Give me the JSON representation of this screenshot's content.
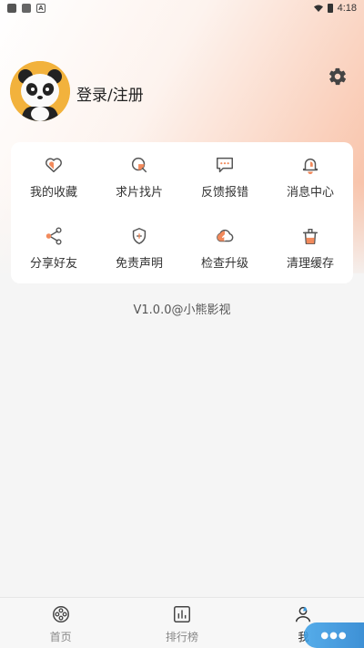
{
  "status_bar": {
    "time": "4:18",
    "icons": [
      "notification-icon",
      "image-icon",
      "a-icon",
      "wifi-icon",
      "battery-icon"
    ]
  },
  "profile": {
    "login_label": "登录/注册",
    "avatar": "panda-avatar",
    "settings_icon": "gear-icon"
  },
  "menu": {
    "items": [
      {
        "label": "我的收藏",
        "icon": "heart-icon"
      },
      {
        "label": "求片找片",
        "icon": "search-film-icon"
      },
      {
        "label": "反馈报错",
        "icon": "feedback-icon"
      },
      {
        "label": "消息中心",
        "icon": "bell-icon"
      },
      {
        "label": "分享好友",
        "icon": "share-icon"
      },
      {
        "label": "免责声明",
        "icon": "shield-icon"
      },
      {
        "label": "检查升级",
        "icon": "cloud-upload-icon"
      },
      {
        "label": "清理缓存",
        "icon": "trash-icon"
      }
    ]
  },
  "version_text": "V1.0.0@小熊影视",
  "bottom_nav": {
    "items": [
      {
        "label": "首页",
        "icon": "film-reel-icon",
        "active": false
      },
      {
        "label": "排行榜",
        "icon": "chart-icon",
        "active": false
      },
      {
        "label": "我",
        "icon": "profile-icon",
        "active": true
      }
    ]
  },
  "colors": {
    "accent": "#f28a5c",
    "icon_stroke": "#555555",
    "hero_gradient_end": "#f6b89c"
  }
}
